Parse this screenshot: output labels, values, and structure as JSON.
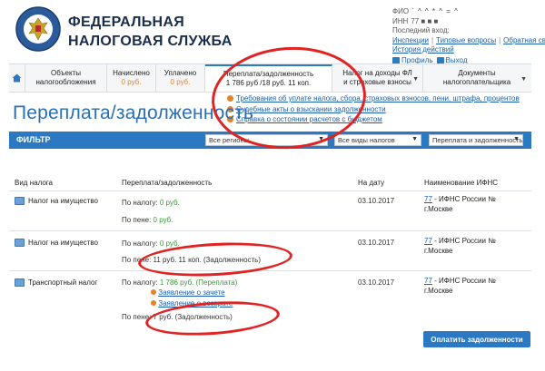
{
  "header": {
    "brand_line1": "ФЕДЕРАЛЬНАЯ",
    "brand_line2": "НАЛОГОВАЯ СЛУЖБА",
    "user": {
      "fio_label": "ФИО",
      "fio_value": "` ^ ^ * ^ = ^",
      "inn_label": "ИНН",
      "inn_value": "77 ■ ■ ■",
      "last_login": "Последний вход:",
      "links": [
        "Инспекции",
        "Типовые вопросы",
        "Обратная связь",
        "История действий"
      ],
      "btn_profile": "Профиль",
      "btn_exit": "Выход"
    }
  },
  "nav": {
    "tabs": [
      {
        "label": "Объекты",
        "label2": "налогообложения",
        "sub": ""
      },
      {
        "label": "Начислено",
        "label2": "",
        "sub": "0 руб."
      },
      {
        "label": "Уплачено",
        "label2": "",
        "sub": "0 руб."
      },
      {
        "label": "Переплата/задолженность",
        "label2": "",
        "sub": "1 786 руб /18 руб. 11 коп."
      },
      {
        "label": "Налог на доходы ФЛ",
        "label2": "и страховые взносы",
        "sub": ""
      },
      {
        "label": "Документы",
        "label2": "налогоплательщика",
        "sub": ""
      }
    ],
    "dropdown": [
      "Требования об уплате налога, сбора, страховых взносов, пени, штрафа, процентов",
      "Судебные акты о взыскании задолженности",
      "Справка о состоянии расчетов с бюджетом"
    ]
  },
  "page": {
    "title": "Переплата/задолженность"
  },
  "filter": {
    "label": "ФИЛЬТР",
    "region": "Все регионы",
    "tax_type": "Все виды налогов",
    "status": "Переплата и задолженность"
  },
  "table": {
    "headers": [
      "Вид налога",
      "Переплата/задолженность",
      "На дату",
      "Наименование ИФНС"
    ],
    "rows": [
      {
        "tax": "Налог на имущество",
        "by_tax_label": "По налогу:",
        "by_tax_value": "0 руб.",
        "by_penalty_label": "По пене:",
        "by_penalty_value": "0 руб.",
        "date": "03.10.2017",
        "ifns_code": "77",
        "ifns_name": " - ИФНС России №",
        "ifns_city": "г.Москве"
      },
      {
        "tax": "Налог на имущество",
        "by_tax_label": "По налогу:",
        "by_tax_value": "0 руб.",
        "by_penalty_label": "По пене:",
        "by_penalty_value": "11 руб. 11 коп. (Задолженность)",
        "date": "03.10.2017",
        "ifns_code": "77",
        "ifns_name": " - ИФНС России №",
        "ifns_city": "г.Москве"
      },
      {
        "tax": "Транспортный налог",
        "by_tax_label": "По налогу:",
        "by_tax_value": "1 786 руб. (Переплата)",
        "zachet_link": "Заявление о зачете",
        "vozvrat_link": "Заявление о возврате",
        "by_penalty_label": "По пене:",
        "by_penalty_value": "7 руб. (Задолженность)",
        "date": "03.10.2017",
        "ifns_code": "77",
        "ifns_name": " - ИФНС России №",
        "ifns_city": "г.Москве"
      }
    ]
  },
  "pay_button": "Оплатить задолженности",
  "colors": {
    "accent": "#2a79c2",
    "title": "#2a6fb4",
    "link": "#1b5fa6",
    "positive": "#3a9a3a",
    "annotation": "#e02424",
    "orange": "#e0862b"
  }
}
